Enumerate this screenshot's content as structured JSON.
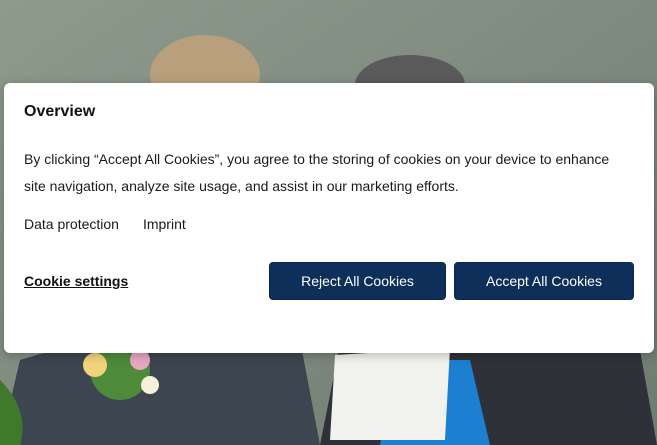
{
  "background": {
    "description_icon": "photo-background"
  },
  "dialog": {
    "title": "Overview",
    "body": "By clicking “Accept All Cookies”, you agree to the storing of cookies on your device to enhance site navigation, analyze site usage, and assist in our marketing efforts.",
    "links": {
      "data_protection": "Data protection",
      "imprint": "Imprint"
    },
    "cookie_settings_label": "Cookie settings",
    "reject_label": "Reject All Cookies",
    "accept_label": "Accept All Cookies"
  },
  "colors": {
    "button_bg": "#0d2f5a",
    "button_text": "#ffffff",
    "dialog_bg": "#ffffff"
  }
}
